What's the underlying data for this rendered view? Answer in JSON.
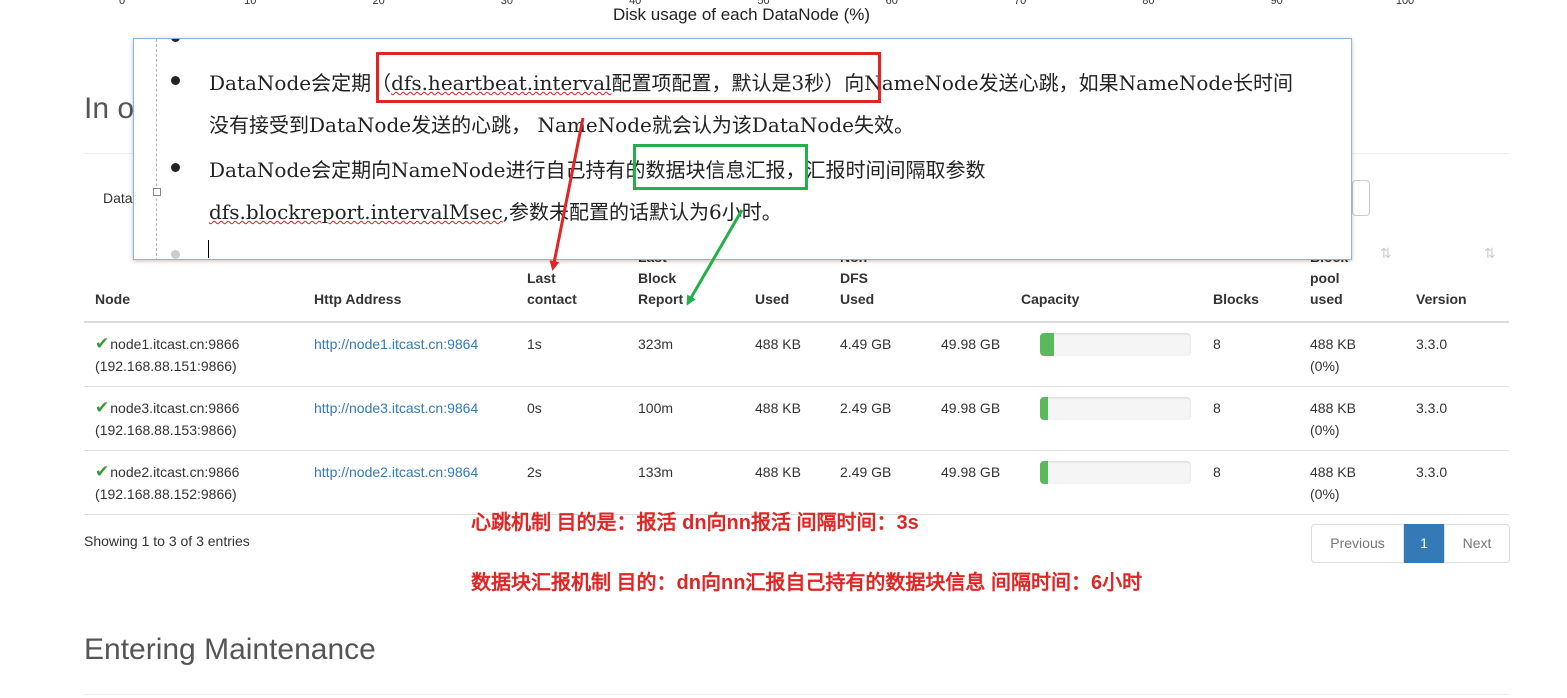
{
  "chart_axis": {
    "ticks": [
      "0",
      "10",
      "20",
      "30",
      "40",
      "50",
      "60",
      "70",
      "80",
      "90",
      "100"
    ],
    "title": "Disk usage of each DataNode (%)"
  },
  "section_in_operation": "In o",
  "control_label": "Data",
  "table": {
    "headers": {
      "node": "Node",
      "http": "Http Address",
      "last_contact_1": "Last",
      "last_contact_2": "contact",
      "last_block_1": "Last",
      "last_block_2": "Block",
      "last_block_3": "Report",
      "used": "Used",
      "non_dfs_1": "Non",
      "non_dfs_2": "DFS",
      "non_dfs_3": "Used",
      "capacity": "Capacity",
      "blocks": "Blocks",
      "bp_1": "Block",
      "bp_2": "pool",
      "bp_3": "used",
      "version": "Version"
    },
    "rows": [
      {
        "node": "node1.itcast.cn:9866",
        "ip": "(192.168.88.151:9866)",
        "http": "http://node1.itcast.cn:9864",
        "last_contact": "1s",
        "last_block": "323m",
        "used": "488 KB",
        "non_dfs": "4.49 GB",
        "capacity": "49.98 GB",
        "capacity_used_pct": 9,
        "blocks": "8",
        "bp_used": "488 KB",
        "bp_pct": "(0%)",
        "version": "3.3.0"
      },
      {
        "node": "node3.itcast.cn:9866",
        "ip": "(192.168.88.153:9866)",
        "http": "http://node3.itcast.cn:9864",
        "last_contact": "0s",
        "last_block": "100m",
        "used": "488 KB",
        "non_dfs": "2.49 GB",
        "capacity": "49.98 GB",
        "capacity_used_pct": 5,
        "blocks": "8",
        "bp_used": "488 KB",
        "bp_pct": "(0%)",
        "version": "3.3.0"
      },
      {
        "node": "node2.itcast.cn:9866",
        "ip": "(192.168.88.152:9866)",
        "http": "http://node2.itcast.cn:9864",
        "last_contact": "2s",
        "last_block": "133m",
        "used": "488 KB",
        "non_dfs": "2.49 GB",
        "capacity": "49.98 GB",
        "capacity_used_pct": 5,
        "blocks": "8",
        "bp_used": "488 KB",
        "bp_pct": "(0%)",
        "version": "3.3.0"
      }
    ]
  },
  "showing": "Showing 1 to 3 of 3 entries",
  "pagination": {
    "previous": "Previous",
    "page": "1",
    "next": "Next"
  },
  "section_maintenance": "Entering Maintenance",
  "note": {
    "line1_a": "DataNode会定期（",
    "line1_b": "dfs.heartbeat.interval",
    "line1_c": "配置项配置，默认是3秒）向NameNode发送心跳，如果NameNode长时间",
    "line2": "没有接受到DataNode发送的心跳， NameNode就会认为该DataNode失效。",
    "line3": "DataNode会定期向NameNode进行自己持有的数据块信息汇报，汇报时间间隔取参数",
    "line4_a": "dfs.blockreport.intervalMsec",
    "line4_b": ",参数未配置的话默认为6小时。"
  },
  "annotations": {
    "heartbeat": "心跳机制 目的是：报活  dn向nn报活   间隔时间：3s",
    "blockreport": "数据块汇报机制 目的：dn向nn汇报自己持有的数据块信息  间隔时间：6小时"
  },
  "colors": {
    "accent": "#337ab7",
    "progress": "#5cb85c",
    "annotation_red": "#e02525",
    "annotation_green": "#22b04a"
  }
}
